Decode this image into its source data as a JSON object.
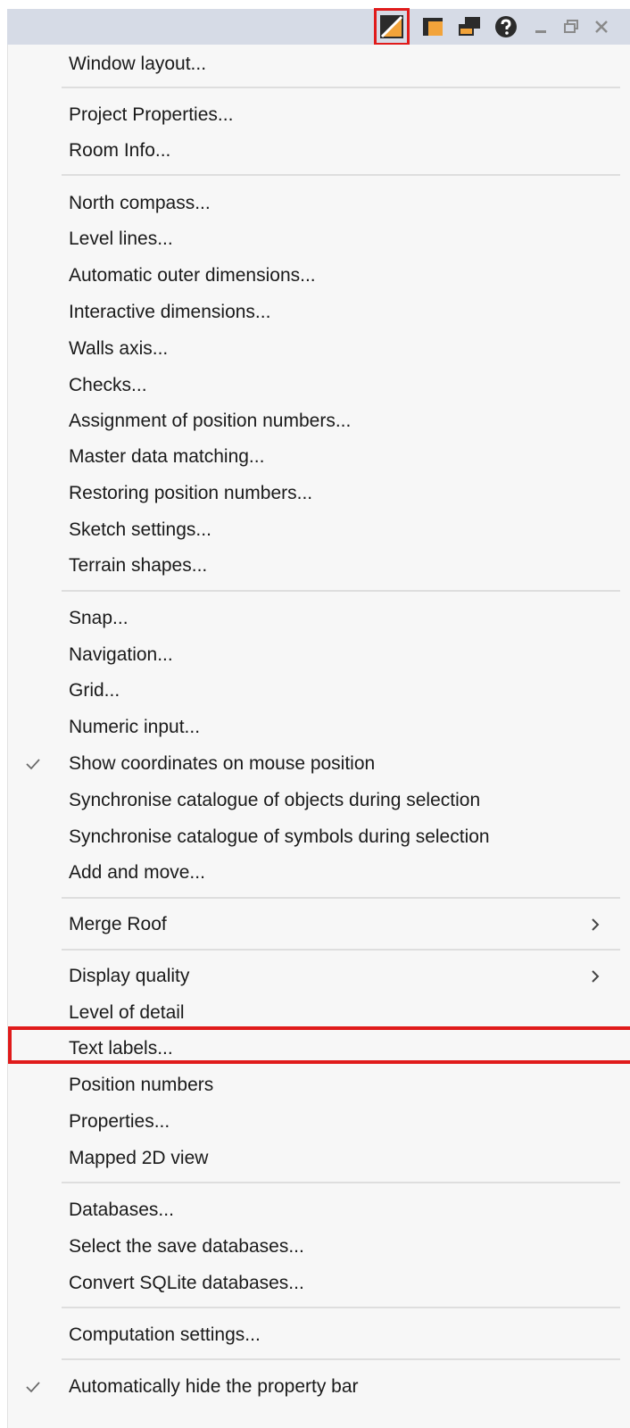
{
  "toolbar": {
    "icons": [
      "display-settings-icon",
      "properties-panel-icon",
      "window-arrange-icon",
      "help-icon",
      "minimize-icon",
      "restore-icon",
      "close-icon"
    ]
  },
  "menu": {
    "sections": [
      {
        "items": [
          {
            "label": "Window layout..."
          }
        ]
      },
      {
        "items": [
          {
            "label": "Project Properties..."
          },
          {
            "label": "Room Info..."
          }
        ]
      },
      {
        "items": [
          {
            "label": "North compass..."
          },
          {
            "label": "Level lines..."
          },
          {
            "label": "Automatic outer dimensions..."
          },
          {
            "label": "Interactive dimensions..."
          },
          {
            "label": "Walls axis..."
          },
          {
            "label": "Checks..."
          },
          {
            "label": "Assignment of position numbers..."
          },
          {
            "label": "Master data matching..."
          },
          {
            "label": "Restoring position numbers..."
          },
          {
            "label": "Sketch settings..."
          },
          {
            "label": "Terrain shapes..."
          }
        ]
      },
      {
        "items": [
          {
            "label": "Snap..."
          },
          {
            "label": "Navigation..."
          },
          {
            "label": "Grid..."
          },
          {
            "label": "Numeric input..."
          },
          {
            "label": "Show coordinates on mouse position",
            "checked": true
          },
          {
            "label": "Synchronise catalogue of objects during selection"
          },
          {
            "label": "Synchronise catalogue of symbols during selection"
          },
          {
            "label": "Add and move..."
          }
        ]
      },
      {
        "items": [
          {
            "label": "Merge Roof",
            "submenu": true
          }
        ]
      },
      {
        "items": [
          {
            "label": "Display quality",
            "submenu": true
          },
          {
            "label": "Level of detail"
          },
          {
            "label": "Text labels...",
            "highlighted": true
          },
          {
            "label": "Position numbers"
          },
          {
            "label": "Properties..."
          },
          {
            "label": "Mapped 2D view"
          }
        ]
      },
      {
        "items": [
          {
            "label": "Databases..."
          },
          {
            "label": "Select the save databases..."
          },
          {
            "label": "Convert SQLite databases..."
          }
        ]
      },
      {
        "items": [
          {
            "label": "Computation settings..."
          }
        ]
      },
      {
        "items": [
          {
            "label": "Automatically hide the property bar",
            "checked": true
          }
        ]
      }
    ]
  },
  "colors": {
    "highlight": "#e01b1b",
    "menu_bg": "#f7f7f7",
    "toolbar_bg": "#d6dbe6"
  }
}
